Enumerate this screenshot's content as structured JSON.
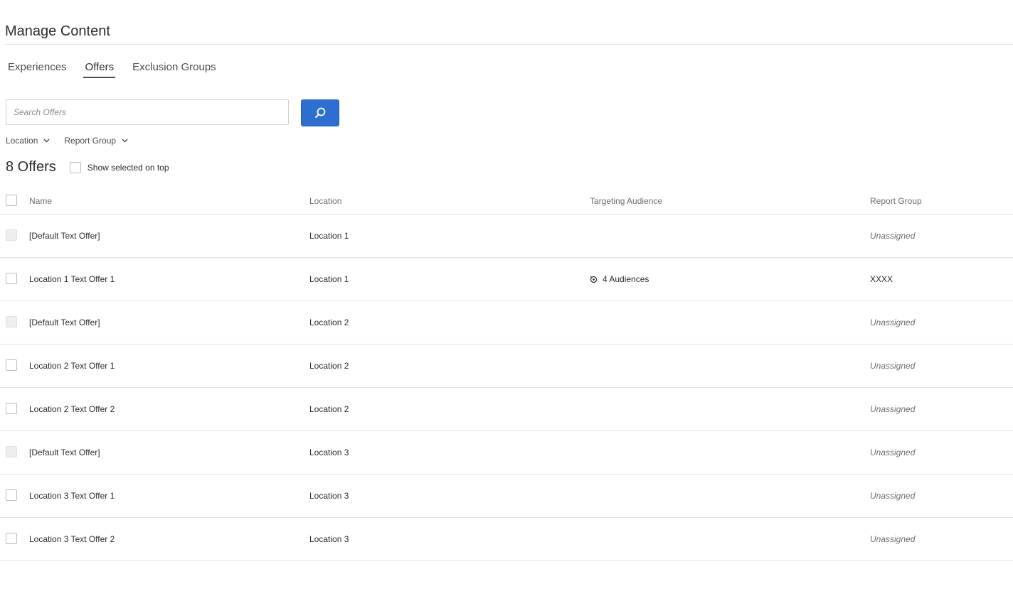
{
  "header": {
    "title": "Manage Content"
  },
  "tabs": [
    {
      "label": "Experiences",
      "active": false
    },
    {
      "label": "Offers",
      "active": true
    },
    {
      "label": "Exclusion Groups",
      "active": false
    }
  ],
  "search": {
    "placeholder": "Search Offers",
    "value": "",
    "button_icon": "search-icon",
    "button_color": "#2d6fd0"
  },
  "filters": [
    {
      "label": "Location",
      "icon": "chevron-down-icon"
    },
    {
      "label": "Report Group",
      "icon": "chevron-down-icon"
    }
  ],
  "summary": {
    "count_label": "8 Offers",
    "show_selected_label": "Show selected on top"
  },
  "table": {
    "columns": [
      "Name",
      "Location",
      "Targeting Audience",
      "Report Group"
    ],
    "rows": [
      {
        "name": "[Default Text Offer]",
        "location": "Location 1",
        "audience": "",
        "report_group": "Unassigned",
        "checkbox_disabled": true
      },
      {
        "name": "Location 1 Text Offer 1",
        "location": "Location 1",
        "audience": "4 Audiences",
        "report_group": "XXXX",
        "checkbox_disabled": false
      },
      {
        "name": "[Default Text Offer]",
        "location": "Location 2",
        "audience": "",
        "report_group": "Unassigned",
        "checkbox_disabled": true
      },
      {
        "name": "Location 2 Text Offer 1",
        "location": "Location 2",
        "audience": "",
        "report_group": "Unassigned",
        "checkbox_disabled": false
      },
      {
        "name": "Location 2 Text Offer 2",
        "location": "Location 2",
        "audience": "",
        "report_group": "Unassigned",
        "checkbox_disabled": false
      },
      {
        "name": "[Default Text Offer]",
        "location": "Location 3",
        "audience": "",
        "report_group": "Unassigned",
        "checkbox_disabled": true
      },
      {
        "name": "Location 3 Text Offer 1",
        "location": "Location 3",
        "audience": "",
        "report_group": "Unassigned",
        "checkbox_disabled": false
      },
      {
        "name": "Location 3 Text Offer 2",
        "location": "Location 3",
        "audience": "",
        "report_group": "Unassigned",
        "checkbox_disabled": false
      }
    ]
  },
  "colors": {
    "link": "#1473e6",
    "primary_button": "#2d6fd0"
  }
}
